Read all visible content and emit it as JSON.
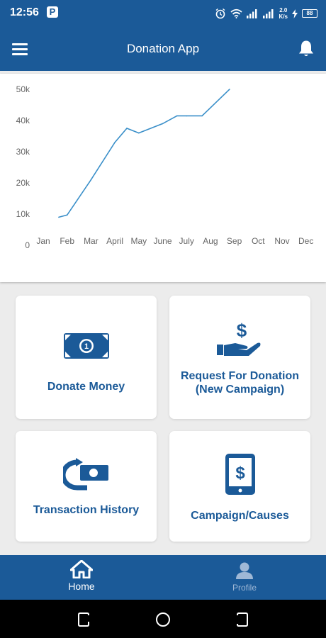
{
  "status": {
    "time": "12:56",
    "notification_icon": "parking-icon",
    "net_speed_value": "2.0",
    "net_speed_unit": "K/s",
    "battery": "88"
  },
  "app_bar": {
    "title": "Donation App",
    "menu_icon": "menu-icon",
    "bell_icon": "bell-icon"
  },
  "chart_data": {
    "type": "line",
    "categories": [
      "Jan",
      "Feb",
      "Mar",
      "April",
      "May",
      "June",
      "July",
      "Aug",
      "Sep",
      "Oct",
      "Nov",
      "Dec"
    ],
    "y_tick_labels": [
      "0",
      "10k",
      "20k",
      "30k",
      "40k",
      "50k"
    ],
    "ylim": [
      0,
      50000
    ],
    "series": [
      {
        "x": [
          0.65,
          1,
          2,
          3,
          3.5,
          4,
          5,
          5.6,
          6,
          6.65,
          7.8
        ],
        "values": [
          9000,
          9700,
          21000,
          33000,
          37500,
          36000,
          39000,
          41500,
          41500,
          41500,
          50000
        ]
      }
    ],
    "color": "#3a8fc9",
    "grid": false,
    "title": "",
    "xlabel": "",
    "ylabel": ""
  },
  "tiles": [
    {
      "label": "Donate Money",
      "icon": "money-bill-icon"
    },
    {
      "label_line1": "Request For Donation",
      "label_line2": "(New Campaign)",
      "icon": "hand-dollar-icon"
    },
    {
      "label": "Transaction History",
      "icon": "money-exchange-icon"
    },
    {
      "label": "Campaign/Causes",
      "icon": "phone-dollar-icon"
    }
  ],
  "bottom_nav": [
    {
      "label": "Home",
      "icon": "home-icon",
      "active": true
    },
    {
      "label": "Profile",
      "icon": "user-icon",
      "active": false
    }
  ],
  "colors": {
    "primary": "#1b5a98",
    "background": "#ececec",
    "card": "#ffffff",
    "chart_line": "#3a8fc9"
  }
}
